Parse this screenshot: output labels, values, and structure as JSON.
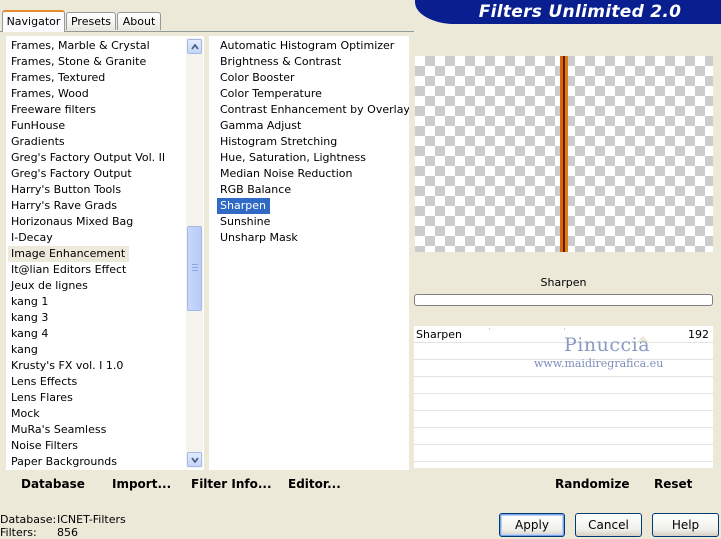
{
  "tabs": [
    {
      "label": "Navigator"
    },
    {
      "label": "Presets"
    },
    {
      "label": "About"
    }
  ],
  "banner": {
    "title": "Filters Unlimited 2.0"
  },
  "categories": {
    "items": [
      "Frames, Marble & Crystal",
      "Frames, Stone & Granite",
      "Frames, Textured",
      "Frames, Wood",
      "Freeware filters",
      "FunHouse",
      "Gradients",
      "Greg's Factory Output Vol. II",
      "Greg's Factory Output",
      "Harry's Button Tools",
      "Harry's Rave Grads",
      "Horizonaus Mixed Bag",
      "I-Decay",
      "Image Enhancement",
      "It@lian Editors Effect",
      "Jeux de lignes",
      "kang 1",
      "kang 3",
      "kang 4",
      "kang",
      "Krusty's FX vol. I 1.0",
      "Lens Effects",
      "Lens Flares",
      "Mock",
      "MuRa's Seamless",
      "Noise Filters",
      "Paper Backgrounds"
    ],
    "selected": "Image Enhancement",
    "scroll_position": 0.55
  },
  "filters": {
    "items": [
      "Automatic Histogram Optimizer",
      "Brightness & Contrast",
      "Color Booster",
      "Color Temperature",
      "Contrast Enhancement by Overlay",
      "Gamma Adjust",
      "Histogram Stretching",
      "Hue, Saturation, Lightness",
      "Median Noise Reduction",
      "RGB Balance",
      "Sharpen",
      "Sunshine",
      "Unsharp Mask"
    ],
    "selected": "Sharpen"
  },
  "filter_name": "Sharpen",
  "param": {
    "label": "Sharpen",
    "value": "192"
  },
  "watermark": {
    "name": "Pinuccia",
    "site": "www.maidiregrafica.eu"
  },
  "toolbar": {
    "database": "Database",
    "import": "Import...",
    "filter_info": "Filter Info...",
    "editor": "Editor...",
    "randomize": "Randomize",
    "reset": "Reset"
  },
  "status": {
    "database_label": "Database:",
    "database_value": "ICNET-Filters",
    "filters_label": "Filters:",
    "filters_value": "856"
  },
  "buttons": {
    "apply": "Apply",
    "cancel": "Cancel",
    "help": "Help"
  },
  "colors": {
    "banner": "#0a1f8f",
    "selection": "#316ac5",
    "preview_stripe_orange": "#d9650c",
    "preview_stripe_dark": "#5a1c00"
  }
}
